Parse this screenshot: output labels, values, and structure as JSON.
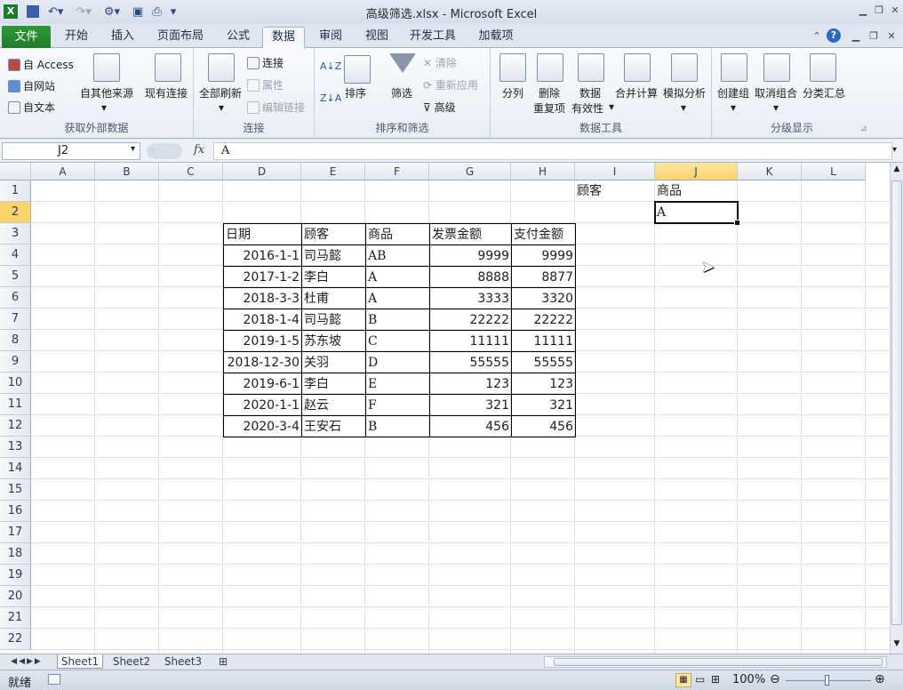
{
  "window": {
    "title": "高级筛选.xlsx - Microsoft Excel"
  },
  "tabs": {
    "file": "文件",
    "items": [
      "开始",
      "插入",
      "页面布局",
      "公式",
      "数据",
      "审阅",
      "视图",
      "开发工具",
      "加载项"
    ],
    "active": "数据"
  },
  "ribbon": {
    "external": {
      "access": "自 Access",
      "web": "自网站",
      "text": "自文本",
      "other_sources": "自其他来源",
      "existing": "现有连接",
      "label": "获取外部数据"
    },
    "connections": {
      "refresh_all": "全部刷新",
      "connections": "连接",
      "properties": "属性",
      "edit_links": "编辑链接",
      "label": "连接"
    },
    "sort_filter": {
      "sort": "排序",
      "filter": "筛选",
      "clear": "清除",
      "reapply": "重新应用",
      "advanced": "高级",
      "label": "排序和筛选"
    },
    "data_tools": {
      "text_to_columns": "分列",
      "remove_dup_1": "删除",
      "remove_dup_2": "重复项",
      "validation_1": "数据",
      "validation_2": "有效性",
      "consolidate": "合并计算",
      "what_if": "模拟分析",
      "label": "数据工具"
    },
    "outline": {
      "group": "创建组",
      "ungroup": "取消组合",
      "subtotal": "分类汇总",
      "label": "分级显示"
    }
  },
  "formula_bar": {
    "name_box": "J2",
    "fx": "fx",
    "content": "A"
  },
  "columns": [
    "A",
    "B",
    "C",
    "D",
    "E",
    "F",
    "G",
    "H",
    "I",
    "J",
    "K",
    "L"
  ],
  "rows": [
    "1",
    "2",
    "3",
    "4",
    "5",
    "6",
    "7",
    "8",
    "9",
    "10",
    "11",
    "12",
    "13",
    "14",
    "15",
    "16",
    "17",
    "18",
    "19",
    "20",
    "21",
    "22"
  ],
  "criteria": {
    "i1": "顾客",
    "j1": "商品",
    "j2": "A"
  },
  "table": {
    "headers": [
      "日期",
      "顾客",
      "商品",
      "发票金额",
      "支付金额"
    ],
    "rows": [
      [
        "2016-1-1",
        "司马懿",
        "AB",
        "9999",
        "9999"
      ],
      [
        "2017-1-2",
        "李白",
        "A",
        "8888",
        "8877"
      ],
      [
        "2018-3-3",
        "杜甫",
        "A",
        "3333",
        "3320"
      ],
      [
        "2018-1-4",
        "司马懿",
        "B",
        "22222",
        "22222"
      ],
      [
        "2019-1-5",
        "苏东坡",
        "C",
        "11111",
        "11111"
      ],
      [
        "2018-12-30",
        "关羽",
        "D",
        "55555",
        "55555"
      ],
      [
        "2019-6-1",
        "李白",
        "E",
        "123",
        "123"
      ],
      [
        "2020-1-1",
        "赵云",
        "F",
        "321",
        "321"
      ],
      [
        "2020-3-4",
        "王安石",
        "B",
        "456",
        "456"
      ]
    ]
  },
  "sheets": [
    "Sheet1",
    "Sheet2",
    "Sheet3"
  ],
  "status": {
    "ready": "就绪",
    "zoom": "100%"
  }
}
